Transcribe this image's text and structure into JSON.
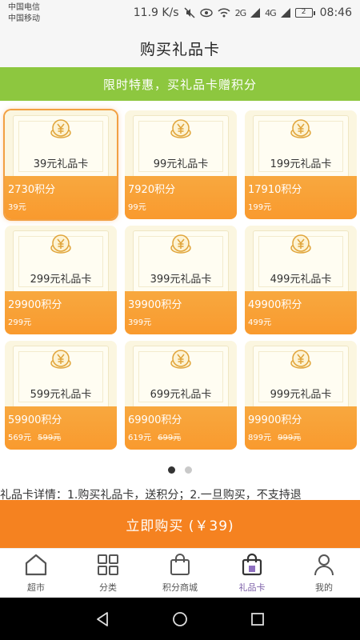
{
  "status": {
    "carrier1": "中国电信",
    "carrier2": "中国移动",
    "speed": "11.9 K/s",
    "signal1": "2G",
    "signal2": "4G",
    "battery": "2",
    "time": "08:46"
  },
  "page_title": "购买礼品卡",
  "promo": "限时特惠，买礼品卡赠积分",
  "cards": [
    {
      "name": "39元礼品卡",
      "points": "2730积分",
      "price": "39元",
      "orig": ""
    },
    {
      "name": "99元礼品卡",
      "points": "7920积分",
      "price": "99元",
      "orig": ""
    },
    {
      "name": "199元礼品卡",
      "points": "17910积分",
      "price": "199元",
      "orig": ""
    },
    {
      "name": "299元礼品卡",
      "points": "29900积分",
      "price": "299元",
      "orig": ""
    },
    {
      "name": "399元礼品卡",
      "points": "39900积分",
      "price": "399元",
      "orig": ""
    },
    {
      "name": "499元礼品卡",
      "points": "49900积分",
      "price": "499元",
      "orig": ""
    },
    {
      "name": "599元礼品卡",
      "points": "59900积分",
      "price": "569元",
      "orig": "599元"
    },
    {
      "name": "699元礼品卡",
      "points": "69900积分",
      "price": "619元",
      "orig": "699元"
    },
    {
      "name": "999元礼品卡",
      "points": "99900积分",
      "price": "899元",
      "orig": "999元"
    }
  ],
  "details": "礼品卡详情：1.购买礼品卡，送积分；2.一旦购买，不支持退",
  "buy_label": "立即购买 (￥39)",
  "nav": [
    {
      "label": "超市",
      "icon": "home-icon"
    },
    {
      "label": "分类",
      "icon": "grid-icon"
    },
    {
      "label": "积分商城",
      "icon": "shopping-bag-icon"
    },
    {
      "label": "礼品卡",
      "icon": "gift-bag-icon"
    },
    {
      "label": "我的",
      "icon": "person-icon"
    }
  ],
  "colors": {
    "accent": "#f58220",
    "promo": "#8dc73f",
    "card_orange": "#f99a2e",
    "nav_active": "#7b5ea7"
  }
}
